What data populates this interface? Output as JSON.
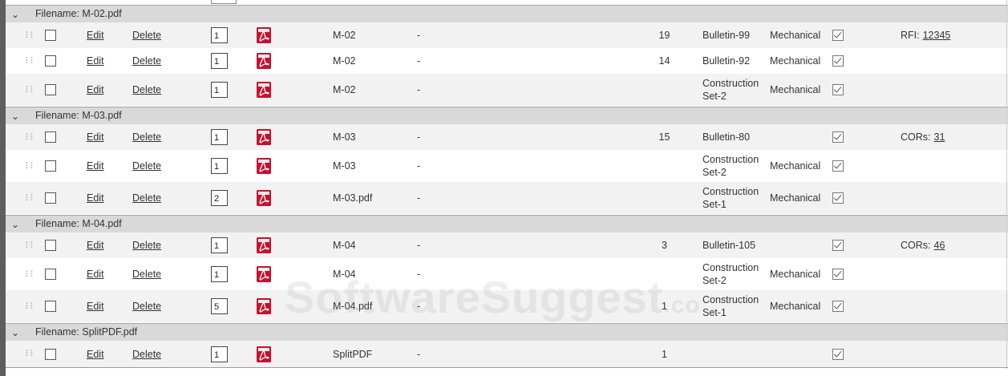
{
  "group_prefix": "Filename:",
  "watermark": {
    "main": "SoftwareSuggest",
    "suffix": ".co"
  },
  "groups": [
    {
      "filename": "M-02.pdf",
      "rows": [
        {
          "order": "1",
          "name": "M-02",
          "dash": "-",
          "number": "19",
          "set": "Bulletin-99",
          "discipline": "Mechanical",
          "ref_label": "RFI:",
          "ref_value": "12345"
        },
        {
          "order": "1",
          "name": "M-02",
          "dash": "-",
          "number": "14",
          "set": "Bulletin-92",
          "discipline": "Mechanical",
          "ref_label": "",
          "ref_value": ""
        },
        {
          "order": "1",
          "name": "M-02",
          "dash": "-",
          "number": "",
          "set": "Construction Set-2",
          "discipline": "Mechanical",
          "ref_label": "",
          "ref_value": ""
        }
      ]
    },
    {
      "filename": "M-03.pdf",
      "rows": [
        {
          "order": "1",
          "name": "M-03",
          "dash": "-",
          "number": "15",
          "set": "Bulletin-80",
          "discipline": "",
          "ref_label": "CORs:",
          "ref_value": "31"
        },
        {
          "order": "1",
          "name": "M-03",
          "dash": "-",
          "number": "",
          "set": "Construction Set-2",
          "discipline": "Mechanical",
          "ref_label": "",
          "ref_value": ""
        },
        {
          "order": "2",
          "name": "M-03.pdf",
          "dash": "-",
          "number": "",
          "set": "Construction Set-1",
          "discipline": "Mechanical",
          "ref_label": "",
          "ref_value": ""
        }
      ]
    },
    {
      "filename": "M-04.pdf",
      "rows": [
        {
          "order": "1",
          "name": "M-04",
          "dash": "-",
          "number": "3",
          "set": "Bulletin-105",
          "discipline": "",
          "ref_label": "CORs:",
          "ref_value": "46"
        },
        {
          "order": "1",
          "name": "M-04",
          "dash": "-",
          "number": "",
          "set": "Construction Set-2",
          "discipline": "Mechanical",
          "ref_label": "",
          "ref_value": ""
        },
        {
          "order": "5",
          "name": "M-04.pdf",
          "dash": "-",
          "number": "1",
          "set": "Construction Set-1",
          "discipline": "Mechanical",
          "ref_label": "",
          "ref_value": ""
        }
      ]
    },
    {
      "filename": "SplitPDF.pdf",
      "rows": [
        {
          "order": "1",
          "name": "SplitPDF",
          "dash": "-",
          "number": "1",
          "set": "",
          "discipline": "",
          "ref_label": "",
          "ref_value": ""
        }
      ]
    }
  ],
  "labels": {
    "edit": "Edit",
    "delete": "Delete"
  },
  "icons": {
    "expand": "chevron-down-icon",
    "drag": "drag-handle-icon",
    "file": "pdf-icon",
    "flag": "check-icon"
  },
  "colors": {
    "group_bg": "#d9d9d9",
    "alt_row_bg": "#f2f2f2",
    "pdf_red": "#c8102e",
    "left_bar": "#5e5e5e"
  }
}
